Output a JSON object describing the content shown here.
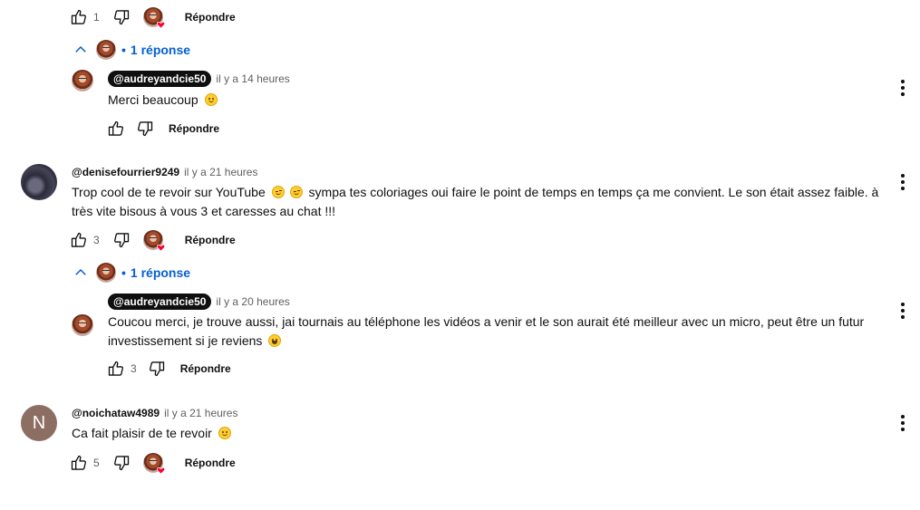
{
  "colors": {
    "link": "#065fd4",
    "badge_bg": "#0f0f0f",
    "heart": "#ff0033",
    "avatar_n_bg": "#8d6e63"
  },
  "icons": [
    "like-icon",
    "dislike-icon",
    "more-vert-icon",
    "chevron-up-icon",
    "heart-icon"
  ],
  "thread1": {
    "like_count": "1",
    "reply_label": "Répondre",
    "toggle_label": "1 réponse",
    "reply": {
      "author": "@audreyandcie50",
      "time": "il y a 14 heures",
      "text": "Merci beaucoup",
      "reply_label": "Répondre"
    }
  },
  "thread2": {
    "author": "@denisefourrier9249",
    "time": "il y a 21 heures",
    "text_part1": "Trop cool  de te revoir sur YouTube",
    "text_part2": " sympa tes coloriages oui faire le point de temps en temps ça me convient. Le son était assez faible. à très vite bisous à vous 3 et caresses au chat !!!",
    "like_count": "3",
    "reply_label": "Répondre",
    "toggle_label": "1 réponse",
    "reply": {
      "author": "@audreyandcie50",
      "time": "il y a 20 heures",
      "text": "Coucou merci, je trouve aussi, jai tournais au téléphone les vidéos a venir et le son aurait été meilleur avec un micro, peut être un futur investissement si je reviens",
      "like_count": "3",
      "reply_label": "Répondre"
    }
  },
  "thread3": {
    "author": "@noichataw4989",
    "avatar_letter": "N",
    "time": "il y a 21 heures",
    "text": "Ca fait plaisir de te revoir",
    "like_count": "5",
    "reply_label": "Répondre"
  }
}
